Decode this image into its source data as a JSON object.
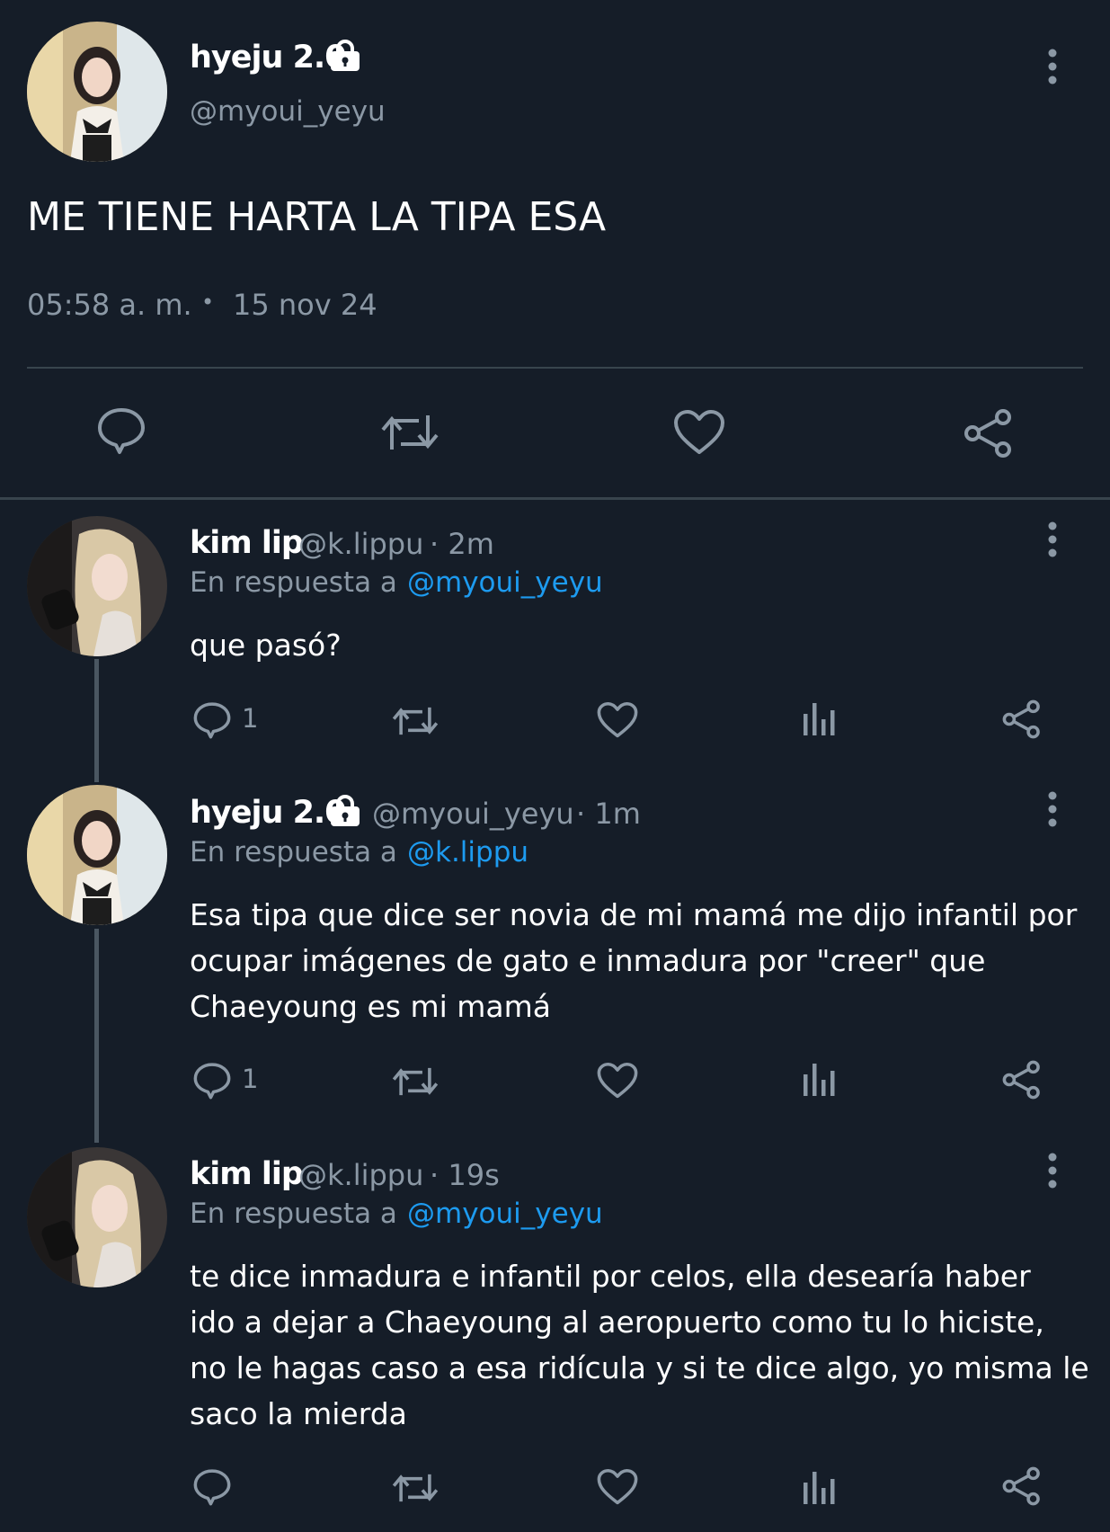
{
  "main_tweet": {
    "display_name": "hyeju 2.0",
    "handle": "@myoui_yeyu",
    "text": "ME TIENE HARTA LA TIPA ESA",
    "time": "05:58 a. m.",
    "separator": "•",
    "date": "15 nov 24"
  },
  "replies": [
    {
      "display_name": "kim lip",
      "handle": "@k.lippu",
      "age": "· 2m",
      "reply_prefix": "En respuesta a",
      "reply_to": "@myoui_yeyu",
      "text": "que pasó?",
      "reply_count": "1"
    },
    {
      "display_name": "hyeju 2.0",
      "handle": "@myoui_yeyu",
      "age": "· 1m",
      "reply_prefix": "En respuesta a",
      "reply_to": "@k.lippu",
      "text": "Esa tipa que dice ser novia de mi mamá me dijo infantil por\nocupar imágenes de gato e inmadura por \"creer\" que\nChaeyoung es mi mamá",
      "reply_count": "1"
    },
    {
      "display_name": "kim lip",
      "handle": "@k.lippu",
      "age": "· 19s",
      "reply_prefix": "En respuesta a",
      "reply_to": "@myoui_yeyu",
      "text": "te dice inmadura e infantil por celos, ella desearía haber\nido a dejar a Chaeyoung al aeropuerto como tu lo hiciste,\nno le hagas caso a esa ridícula y si te dice algo, yo misma le\nsaco la mierda",
      "reply_count": ""
    }
  ],
  "icons": [
    "lock-icon",
    "more-icon",
    "reply-icon",
    "retweet-icon",
    "like-icon",
    "share-icon",
    "views-icon"
  ],
  "colors": {
    "background": "#151d28",
    "muted": "#8b98a5",
    "link": "#1d9bf0",
    "divider": "#38444d"
  }
}
